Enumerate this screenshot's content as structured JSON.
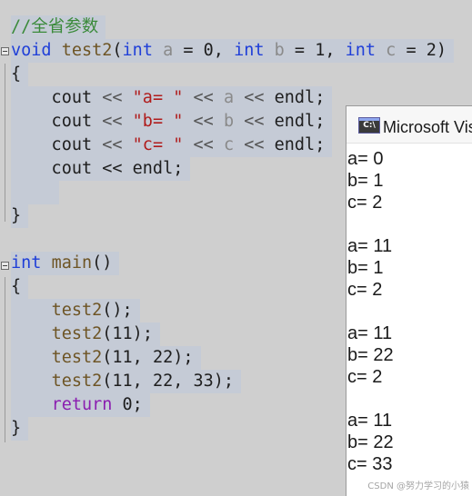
{
  "editor": {
    "lines": [
      {
        "parts": [
          {
            "t": "//全省参数",
            "c": "c-comment"
          }
        ]
      },
      {
        "parts": [
          {
            "t": "void",
            "c": "c-kw"
          },
          {
            "t": " ",
            "c": "c-plain"
          },
          {
            "t": "test2",
            "c": "c-fn"
          },
          {
            "t": "(",
            "c": "c-plain"
          },
          {
            "t": "int",
            "c": "c-kw"
          },
          {
            "t": " ",
            "c": "c-plain"
          },
          {
            "t": "a",
            "c": "c-param"
          },
          {
            "t": " = 0, ",
            "c": "c-plain"
          },
          {
            "t": "int",
            "c": "c-kw"
          },
          {
            "t": " ",
            "c": "c-plain"
          },
          {
            "t": "b",
            "c": "c-param"
          },
          {
            "t": " = 1, ",
            "c": "c-plain"
          },
          {
            "t": "int",
            "c": "c-kw"
          },
          {
            "t": " ",
            "c": "c-plain"
          },
          {
            "t": "c",
            "c": "c-param"
          },
          {
            "t": " = 2)",
            "c": "c-plain"
          }
        ]
      },
      {
        "parts": [
          {
            "t": "{",
            "c": "c-plain"
          }
        ]
      },
      {
        "parts": [
          {
            "t": "    cout ",
            "c": "c-plain"
          },
          {
            "t": "<<",
            "c": "c-op"
          },
          {
            "t": " ",
            "c": "c-plain"
          },
          {
            "t": "\"a= \"",
            "c": "c-str"
          },
          {
            "t": " ",
            "c": "c-plain"
          },
          {
            "t": "<<",
            "c": "c-op"
          },
          {
            "t": " ",
            "c": "c-plain"
          },
          {
            "t": "a",
            "c": "c-param"
          },
          {
            "t": " ",
            "c": "c-plain"
          },
          {
            "t": "<<",
            "c": "c-op"
          },
          {
            "t": " endl;",
            "c": "c-plain"
          }
        ]
      },
      {
        "parts": [
          {
            "t": "    cout ",
            "c": "c-plain"
          },
          {
            "t": "<<",
            "c": "c-op"
          },
          {
            "t": " ",
            "c": "c-plain"
          },
          {
            "t": "\"b= \"",
            "c": "c-str"
          },
          {
            "t": " ",
            "c": "c-plain"
          },
          {
            "t": "<<",
            "c": "c-op"
          },
          {
            "t": " ",
            "c": "c-plain"
          },
          {
            "t": "b",
            "c": "c-param"
          },
          {
            "t": " ",
            "c": "c-plain"
          },
          {
            "t": "<<",
            "c": "c-op"
          },
          {
            "t": " endl;",
            "c": "c-plain"
          }
        ]
      },
      {
        "parts": [
          {
            "t": "    cout ",
            "c": "c-plain"
          },
          {
            "t": "<<",
            "c": "c-op"
          },
          {
            "t": " ",
            "c": "c-plain"
          },
          {
            "t": "\"c= \"",
            "c": "c-str"
          },
          {
            "t": " ",
            "c": "c-plain"
          },
          {
            "t": "<<",
            "c": "c-op"
          },
          {
            "t": " ",
            "c": "c-plain"
          },
          {
            "t": "c",
            "c": "c-param"
          },
          {
            "t": " ",
            "c": "c-plain"
          },
          {
            "t": "<<",
            "c": "c-op"
          },
          {
            "t": " endl;",
            "c": "c-plain"
          }
        ]
      },
      {
        "parts": [
          {
            "t": "    cout << endl;",
            "c": "c-plain"
          }
        ]
      },
      {
        "parts": [
          {
            "t": "    ",
            "c": "c-plain"
          }
        ]
      },
      {
        "parts": [
          {
            "t": "}",
            "c": "c-plain"
          }
        ]
      },
      {
        "parts": []
      },
      {
        "parts": [
          {
            "t": "int",
            "c": "c-kw"
          },
          {
            "t": " ",
            "c": "c-plain"
          },
          {
            "t": "main",
            "c": "c-fn"
          },
          {
            "t": "()",
            "c": "c-plain"
          }
        ]
      },
      {
        "parts": [
          {
            "t": "{",
            "c": "c-plain"
          }
        ]
      },
      {
        "parts": [
          {
            "t": "    ",
            "c": "c-plain"
          },
          {
            "t": "test2",
            "c": "c-fn"
          },
          {
            "t": "();",
            "c": "c-plain"
          }
        ]
      },
      {
        "parts": [
          {
            "t": "    ",
            "c": "c-plain"
          },
          {
            "t": "test2",
            "c": "c-fn"
          },
          {
            "t": "(11);",
            "c": "c-plain"
          }
        ]
      },
      {
        "parts": [
          {
            "t": "    ",
            "c": "c-plain"
          },
          {
            "t": "test2",
            "c": "c-fn"
          },
          {
            "t": "(11, 22);",
            "c": "c-plain"
          }
        ]
      },
      {
        "parts": [
          {
            "t": "    ",
            "c": "c-plain"
          },
          {
            "t": "test2",
            "c": "c-fn"
          },
          {
            "t": "(11, 22, 33);",
            "c": "c-plain"
          }
        ]
      },
      {
        "parts": [
          {
            "t": "    ",
            "c": "c-plain"
          },
          {
            "t": "return",
            "c": "c-kw2"
          },
          {
            "t": " 0;",
            "c": "c-plain"
          }
        ]
      },
      {
        "parts": [
          {
            "t": "}",
            "c": "c-plain"
          }
        ]
      }
    ]
  },
  "console": {
    "icon_label": "C:\\",
    "title": "Microsoft Visual Studio 调试控制台",
    "output": [
      "a= 0",
      "b= 1",
      "c= 2",
      "",
      "a= 11",
      "b= 1",
      "c= 2",
      "",
      "a= 11",
      "b= 22",
      "c= 2",
      "",
      "a= 11",
      "b= 22",
      "c= 33"
    ]
  },
  "watermark": "CSDN @努力学习的小猿"
}
